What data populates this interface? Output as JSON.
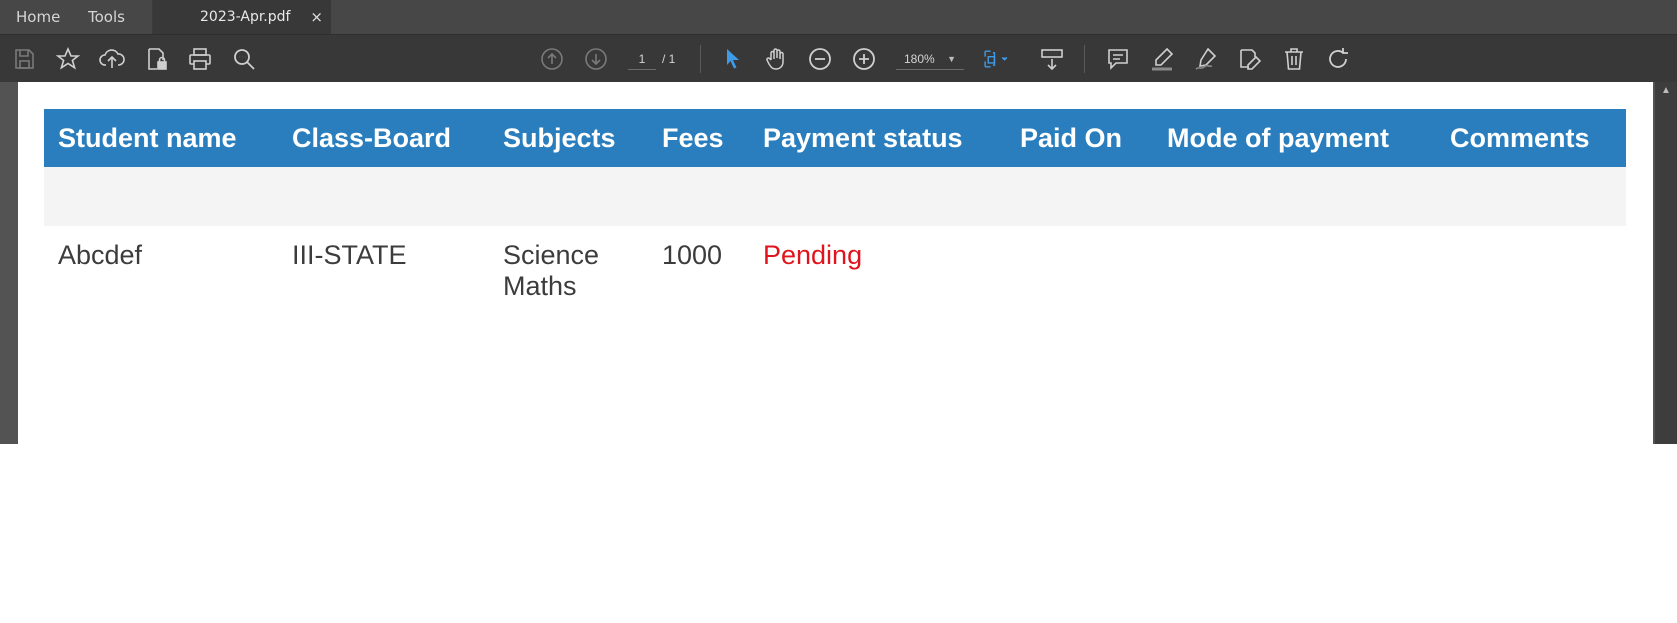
{
  "tabs": {
    "home": "Home",
    "tools": "Tools",
    "document": "2023-Apr.pdf",
    "close": "×"
  },
  "toolbar": {
    "page_current": "1",
    "page_total": "/ 1",
    "zoom": "180%",
    "zoom_caret": "▼"
  },
  "colors": {
    "header_bg": "#2a7ebd",
    "status_pending": "#e0141c",
    "accent_blue": "#3f9ae8"
  },
  "table": {
    "headers": [
      "Student name",
      "Class-Board",
      "Subjects",
      "Fees",
      "Payment status",
      "Paid On",
      "Mode of payment",
      "Comments"
    ],
    "rows": [
      {
        "student_name": "Abcdef",
        "class_board": "III-STATE",
        "subjects": [
          "Science",
          "Maths"
        ],
        "fees": "1000",
        "payment_status": "Pending",
        "paid_on": "",
        "mode_of_payment": "",
        "comments": ""
      }
    ]
  }
}
